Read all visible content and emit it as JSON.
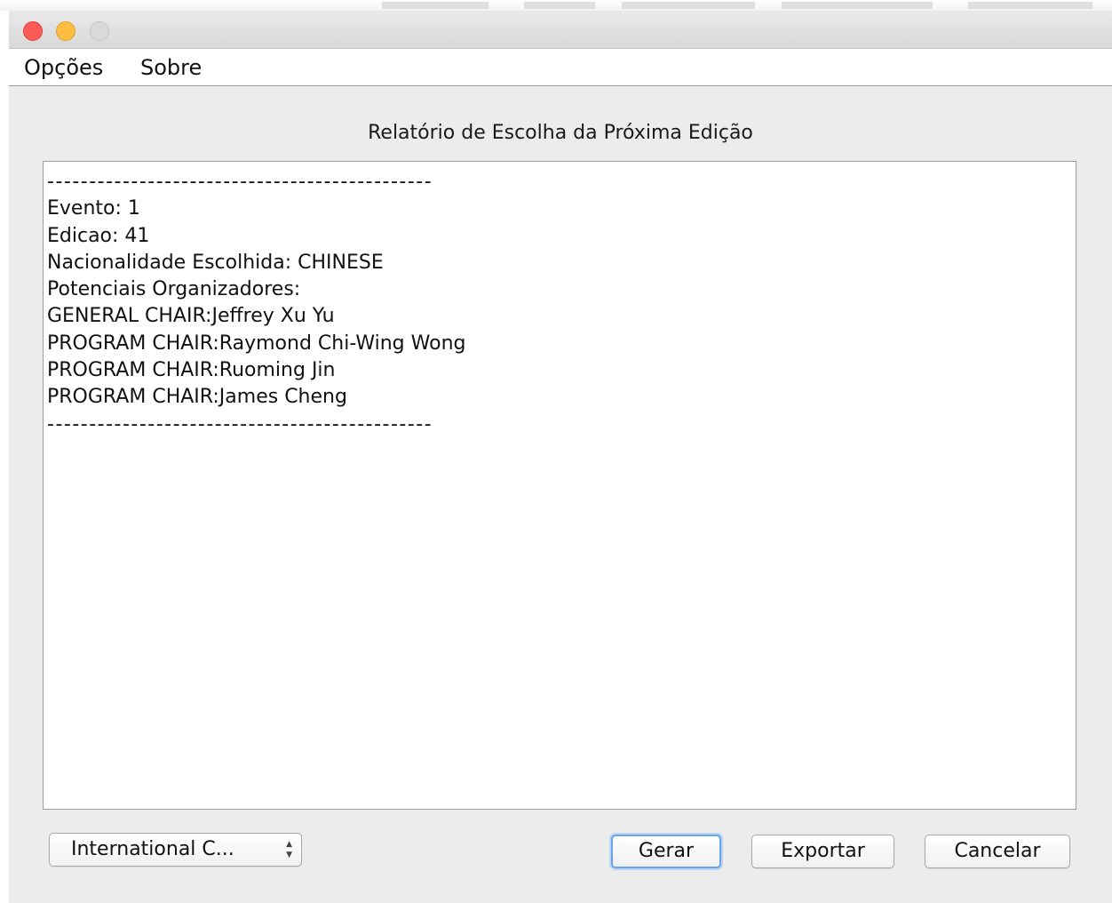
{
  "window": {
    "title": "",
    "controls": [
      "close",
      "minimize",
      "zoom"
    ]
  },
  "menubar": {
    "items": [
      {
        "label": "Opções"
      },
      {
        "label": "Sobre"
      }
    ]
  },
  "panel": {
    "title": "Relatório de Escolha da Próxima Edição"
  },
  "report": {
    "lines": [
      "----------------------------------------------",
      "Evento: 1",
      "Edicao: 41",
      "Nacionalidade Escolhida: CHINESE",
      "Potenciais Organizadores:",
      "GENERAL CHAIR:Jeffrey Xu Yu",
      "PROGRAM CHAIR:Raymond Chi-Wing Wong",
      "PROGRAM CHAIR:Ruoming Jin",
      "PROGRAM CHAIR:James Cheng",
      "----------------------------------------------"
    ]
  },
  "footer": {
    "event_select": {
      "selected": "International C...",
      "arrow_up": "▲",
      "arrow_down": "▼"
    },
    "buttons": {
      "generate": "Gerar",
      "export": "Exportar",
      "cancel": "Cancelar"
    }
  },
  "colors": {
    "window_bg": "#ececec",
    "close": "#fc5b57",
    "minimize": "#fdbd41",
    "zoom_disabled": "#d9d9d9",
    "focus_ring": "#6aa3ea"
  }
}
